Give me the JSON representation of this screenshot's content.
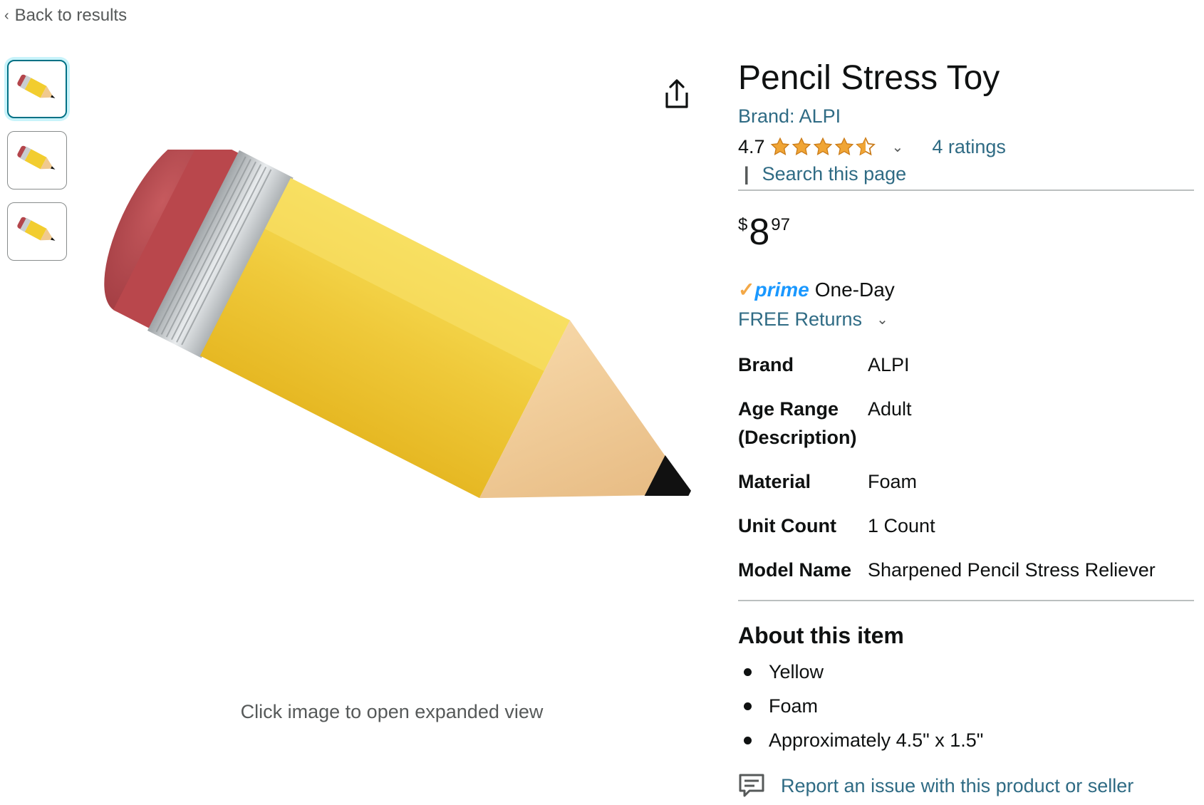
{
  "nav": {
    "back_label": "Back to results"
  },
  "image": {
    "hint": "Click image to open expanded view"
  },
  "product": {
    "title": "Pencil Stress Toy",
    "brand_link": "Brand: ALPI",
    "rating": "4.7",
    "ratings_link": "4 ratings",
    "search_sep": "|",
    "search_link": "Search this page",
    "price_symbol": "$",
    "price_whole": "8",
    "price_fraction": "97",
    "prime_word": "prime",
    "prime_text": "One-Day",
    "returns_label": "FREE Returns"
  },
  "specs": [
    {
      "key": "Brand",
      "value": "ALPI"
    },
    {
      "key": "Age Range (Description)",
      "value": "Adult"
    },
    {
      "key": "Material",
      "value": "Foam"
    },
    {
      "key": "Unit Count",
      "value": "1 Count"
    },
    {
      "key": "Model Name",
      "value": "Sharpened Pencil Stress Reliever"
    }
  ],
  "about": {
    "title": "About this item",
    "bullets": [
      "Yellow",
      "Foam",
      "Approximately 4.5\" x 1.5\""
    ]
  },
  "report": {
    "label": "Report an issue with this product or seller"
  },
  "colors": {
    "link": "#2F6B84",
    "prime_blue": "#1A98FF",
    "star": "#DE7921",
    "text": "#0F1111"
  },
  "icons": [
    "chevron-left-icon",
    "share-icon",
    "star-icon",
    "chevron-down-icon",
    "feedback-icon"
  ]
}
